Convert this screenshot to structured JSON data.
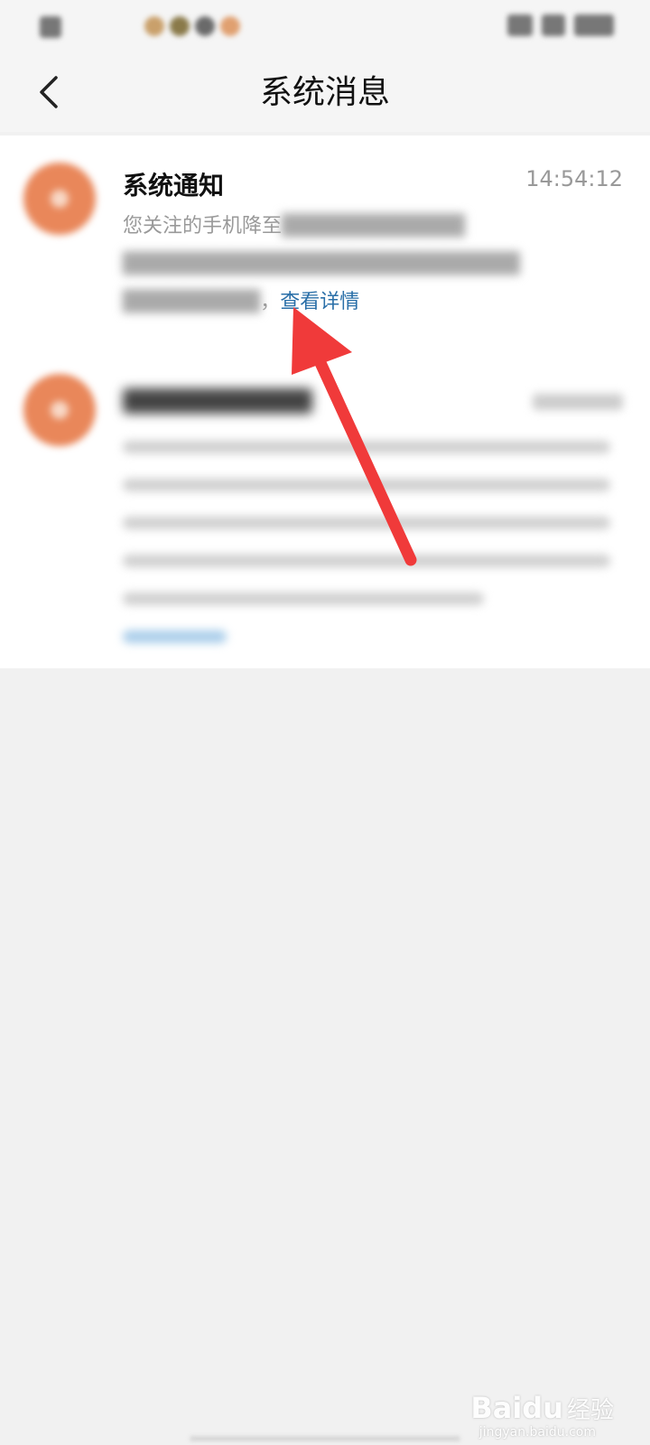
{
  "nav": {
    "title": "系统消息"
  },
  "messages": [
    {
      "title": "系统通知",
      "time": "14:54:12",
      "body_prefix": "您关注的手机降至",
      "link_label": "查看详情"
    }
  ],
  "watermark": {
    "logo": "Baidu",
    "label": "经验",
    "url": "jingyan.baidu.com"
  },
  "icons": {
    "back": "chevron-left-icon",
    "avatar": "system-notification-icon"
  },
  "colors": {
    "accent_link": "#2a6fa8",
    "avatar": "#e9875a",
    "annotation_arrow": "#f03a3a"
  }
}
